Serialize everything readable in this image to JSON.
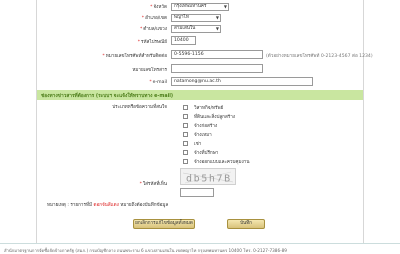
{
  "form": {
    "province": {
      "label": "จังหวัด",
      "value": "กรุงเทพมหานคร"
    },
    "district": {
      "label": "อำเภอ/เขต",
      "value": "พญาไท"
    },
    "subdistrict": {
      "label": "ตำบล/แขวง",
      "value": "สามเสนใน"
    },
    "postcode": {
      "label": "รหัสไปรษณีย์",
      "value": "10400"
    },
    "phone": {
      "label": "หมายเลขโทรศัพท์สำหรับติดต่อ",
      "value": "0-5596-1156",
      "hint": "(ตัวอย่างหมายเลขโทรศัพท์ 0-2123-4567 ต่อ 1234)"
    },
    "fax": {
      "label": "หมายเลขโทรสาร",
      "value": ""
    },
    "email": {
      "label": "e-mail",
      "value": "natamong@nu.ac.th"
    }
  },
  "section": {
    "title": "ช่องทางข่าวสารที่ต้องการ (ระบบฯ จะแจ้งให้ทราบทาง e-mail)"
  },
  "news": {
    "label": "ประเภทหรือข้อความที่สนใจ",
    "items": [
      {
        "label": "วิสาหกิจ/ทรัพย์"
      },
      {
        "label": "ที่ดินและสิ่งปลูกสร้าง"
      },
      {
        "label": "จ้างก่อสร้าง"
      },
      {
        "label": "จ้างเหมา"
      },
      {
        "label": "เช่า"
      },
      {
        "label": "จ้างที่ปรึกษา"
      },
      {
        "label": "จ้างออกแบบและควบคุมงาน"
      }
    ]
  },
  "captcha": {
    "label": "ใส่รหัสที่เห็น",
    "code": "db5h7B",
    "value": ""
  },
  "note": {
    "prefix": "หมายเหตุ : รายการที่มี",
    "highlight": "ดอกจันสีแดง",
    "suffix": "หมายถึงต้องบันทึกข้อมูล"
  },
  "buttons": {
    "reset": "ยกเลิกการแก้ไขข้อมูลทั้งหมด",
    "save": "บันทึก"
  },
  "footer": {
    "text": "สำนักมาตรฐานการจัดซื้อจัดจ้างภาครัฐ (สมภ.) กรมบัญชีกลาง ถนนพระราม 6 แขวงสามเสนใน เขตพญาไท กรุงเทพมหานคร 10400 โทร. 0-2127-7386-89"
  },
  "colors": {
    "section_bg": "#c9e6a0",
    "section_text": "#4c7d1a",
    "required": "#dd2222",
    "button": "#e4d18c"
  }
}
